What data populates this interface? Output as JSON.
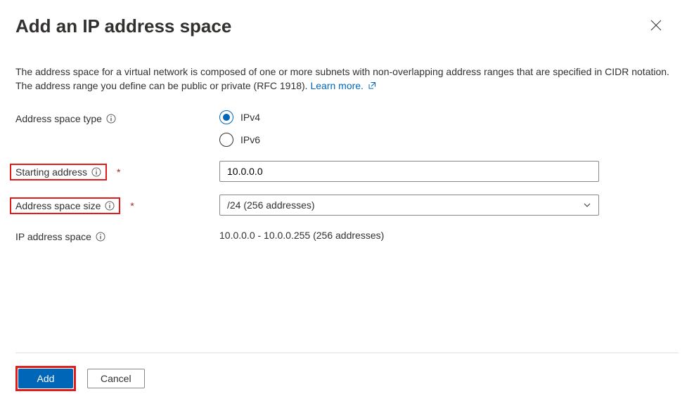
{
  "header": {
    "title": "Add an IP address space"
  },
  "description": {
    "text": "The address space for a virtual network is composed of one or more subnets with non-overlapping address ranges that are specified in CIDR notation. The address range you define can be public or private (RFC 1918).",
    "learn_more_label": "Learn more."
  },
  "form": {
    "address_space_type": {
      "label": "Address space type",
      "options": {
        "ipv4": "IPv4",
        "ipv6": "IPv6"
      },
      "selected": "ipv4"
    },
    "starting_address": {
      "label": "Starting address",
      "value": "10.0.0.0"
    },
    "address_space_size": {
      "label": "Address space size",
      "value": "/24 (256 addresses)"
    },
    "ip_address_space": {
      "label": "IP address space",
      "value": "10.0.0.0 - 10.0.0.255 (256 addresses)"
    }
  },
  "footer": {
    "add_label": "Add",
    "cancel_label": "Cancel"
  }
}
